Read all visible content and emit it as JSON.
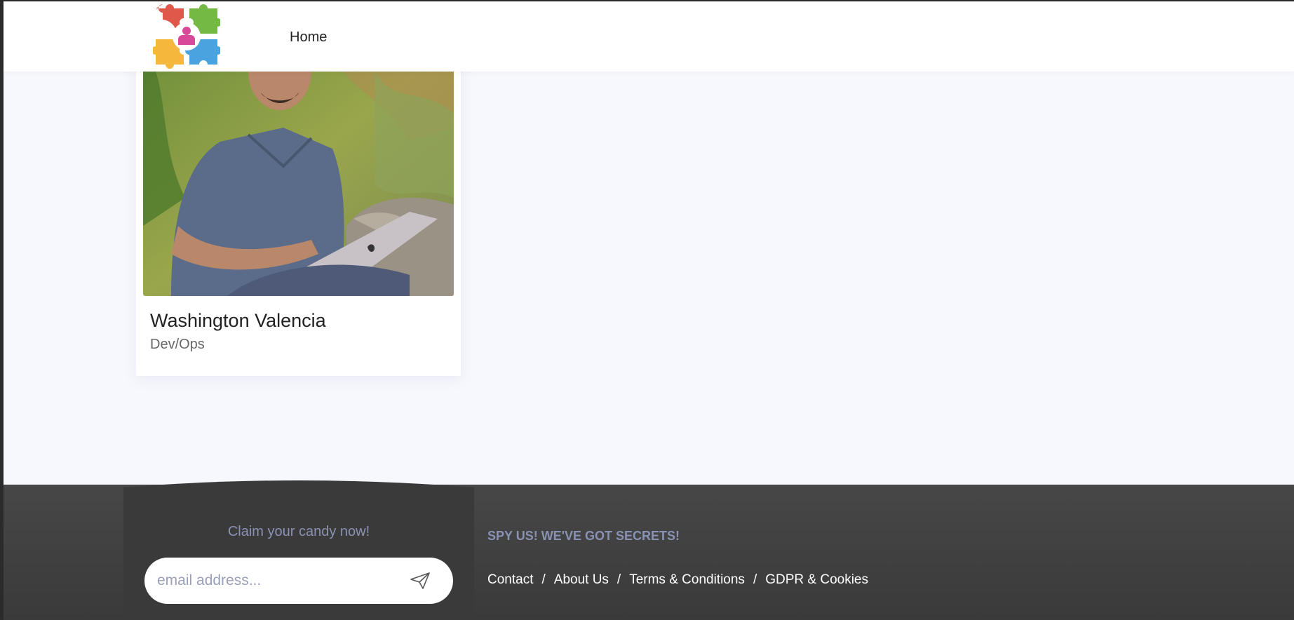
{
  "header": {
    "logo_alt": "Team puzzle logo",
    "nav": {
      "home_label": "Home"
    }
  },
  "team_card": {
    "name": "Washington Valencia",
    "role": "Dev/Ops"
  },
  "footer": {
    "newsletter": {
      "heading": "Claim your candy now!",
      "email_placeholder": "email address...",
      "send_icon": "paper-plane-icon"
    },
    "secrets_heading": "SPY US! WE'VE GOT SECRETS!",
    "links": [
      {
        "label": "Contact"
      },
      {
        "label": "About Us"
      },
      {
        "label": "Terms & Conditions"
      },
      {
        "label": "GDPR & Cookies"
      }
    ],
    "link_separator": "/"
  },
  "colors": {
    "page_background": "#f7f8fd",
    "footer_background": "#404040",
    "footer_muted_text": "#8a92b4"
  }
}
